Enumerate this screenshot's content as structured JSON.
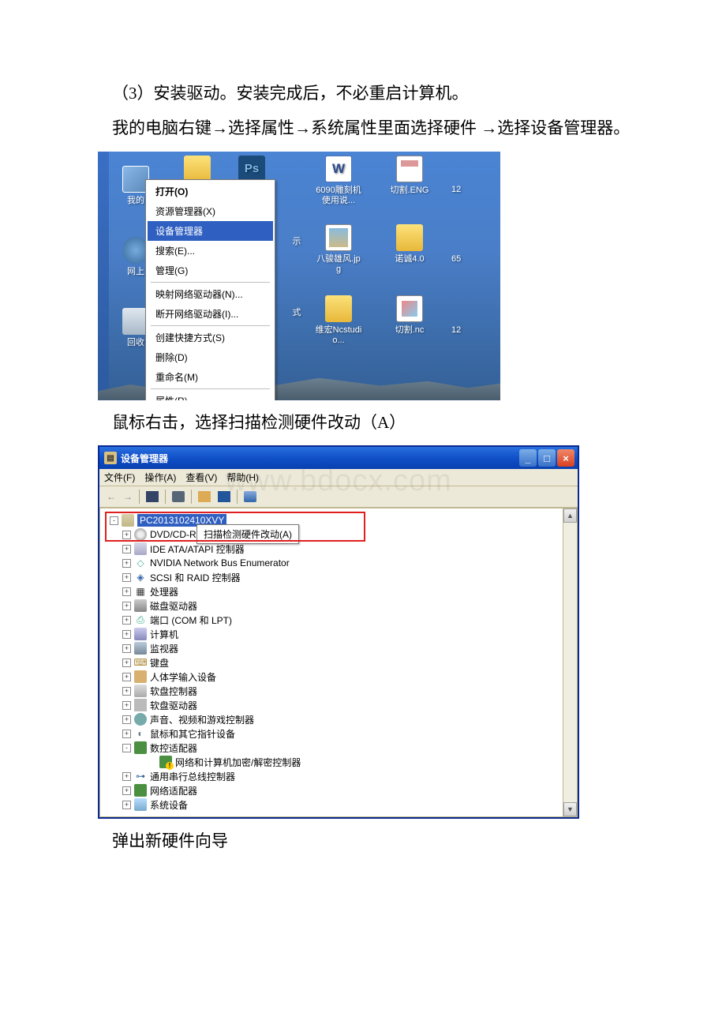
{
  "doc": {
    "p1": "（3）安装驱动。安装完成后，不必重启计算机。",
    "p2": "我的电脑右键→选择属性→系统属性里面选择硬件 →选择设备管理器。",
    "p3": "鼠标右击，选择扫描检测硬件改动（A）",
    "p4": "弹出新硬件向导"
  },
  "ctx_menu": {
    "items": [
      {
        "label": "打开(O)",
        "bold": true
      },
      {
        "label": "资源管理器(X)"
      },
      {
        "label": "设备管理器",
        "sel": true
      },
      {
        "label": "搜索(E)..."
      },
      {
        "label": "管理(G)"
      },
      {
        "sep": true
      },
      {
        "label": "映射网络驱动器(N)..."
      },
      {
        "label": "断开网络驱动器(I)..."
      },
      {
        "sep": true
      },
      {
        "label": "创建快捷方式(S)"
      },
      {
        "label": "删除(D)"
      },
      {
        "label": "重命名(M)"
      },
      {
        "sep": true
      },
      {
        "label": "属性(R)"
      }
    ]
  },
  "desktop_icons": {
    "my_computer": "我的",
    "net_places": "网上",
    "recycle": "回收",
    "show": "示",
    "rec2": "式",
    "ps": "Ps",
    "word_icon": "W",
    "word1": "6090雕刻机使用说...",
    "eng": "切割.ENG",
    "eng_num": "12",
    "jpg": "八骏雄风.jpg",
    "folder": "诺诚4.0",
    "folder_num": "65",
    "wh": "维宏Ncstudio...",
    "nc": "切割.nc",
    "nc_num": "12"
  },
  "device_manager": {
    "title": "设备管理器",
    "watermark": "www.bdocx.com",
    "menus": {
      "file": "文件(F)",
      "action": "操作(A)",
      "view": "查看(V)",
      "help": "帮助(H)"
    },
    "root": "PC2013102410XVY",
    "context": "扫描检测硬件改动(A)",
    "tree": [
      {
        "icon": "di-cd",
        "label": "DVD/CD-R",
        "toggle": "+"
      },
      {
        "icon": "di-ide",
        "label": "IDE ATA/ATAPI 控制器",
        "toggle": "+"
      },
      {
        "icon": "di-net",
        "label": "NVIDIA Network Bus Enumerator",
        "toggle": "+",
        "glyph": "◇"
      },
      {
        "icon": "di-scsi",
        "label": "SCSI 和 RAID 控制器",
        "toggle": "+",
        "glyph": "◈"
      },
      {
        "icon": "di-cpu",
        "label": "处理器",
        "toggle": "+",
        "glyph": "▦"
      },
      {
        "icon": "di-disk",
        "label": "磁盘驱动器",
        "toggle": "+"
      },
      {
        "icon": "di-port",
        "label": "端口 (COM 和 LPT)",
        "toggle": "+",
        "glyph": "⎙"
      },
      {
        "icon": "di-comp",
        "label": "计算机",
        "toggle": "+"
      },
      {
        "icon": "di-mon",
        "label": "监视器",
        "toggle": "+"
      },
      {
        "icon": "di-key",
        "label": "键盘",
        "toggle": "+",
        "glyph": "⌨"
      },
      {
        "icon": "di-hid",
        "label": "人体学输入设备",
        "toggle": "+"
      },
      {
        "icon": "di-fdc",
        "label": "软盘控制器",
        "toggle": "+"
      },
      {
        "icon": "di-fdd",
        "label": "软盘驱动器",
        "toggle": "+"
      },
      {
        "icon": "di-snd",
        "label": "声音、视频和游戏控制器",
        "toggle": "+"
      },
      {
        "icon": "di-mouse",
        "label": "鼠标和其它指针设备",
        "toggle": "+",
        "glyph": "◐"
      },
      {
        "icon": "di-green",
        "label": "数控适配器",
        "toggle": "-",
        "open": true
      },
      {
        "icon": "di-green di-warn",
        "label": "网络和计算机加密/解密控制器",
        "indent": 2
      },
      {
        "icon": "di-usb",
        "label": "通用串行总线控制器",
        "toggle": "+",
        "glyph": "⊶"
      },
      {
        "icon": "di-green",
        "label": "网络适配器",
        "toggle": "+"
      },
      {
        "icon": "di-sys",
        "label": "系统设备",
        "toggle": "+"
      }
    ]
  }
}
